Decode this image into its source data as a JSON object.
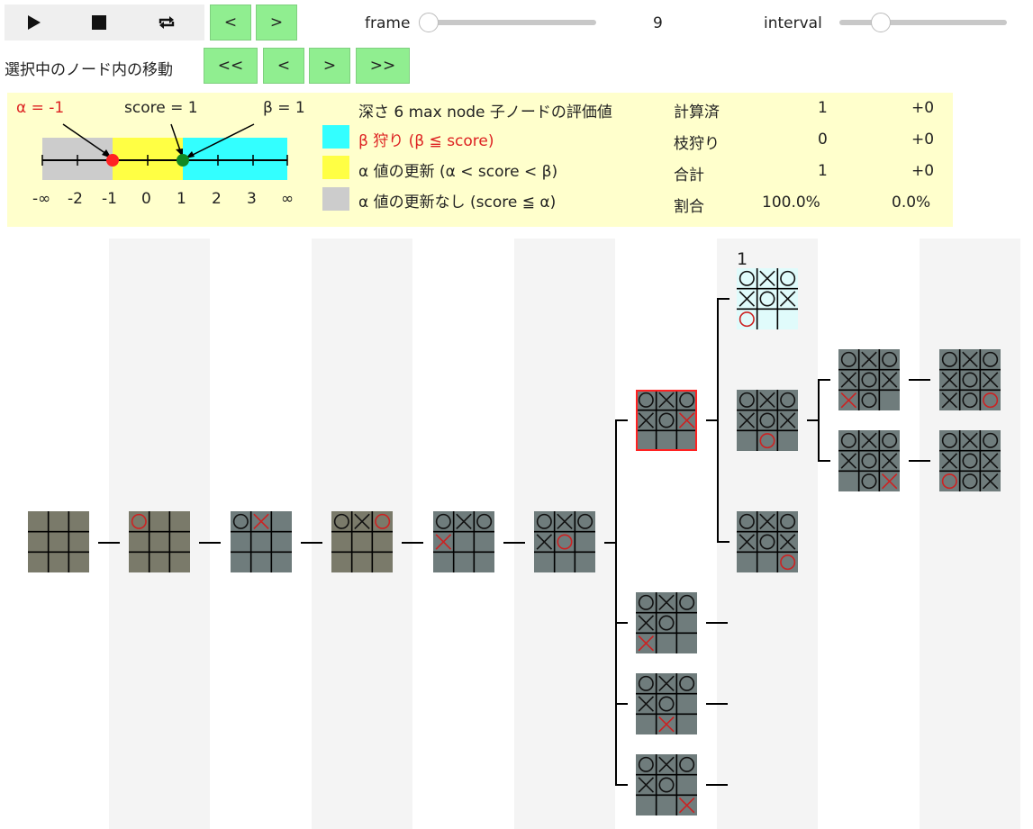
{
  "toolbar": {
    "play_icon": "play-icon",
    "stop_icon": "stop-icon",
    "repeat_icon": "repeat-icon",
    "prev_label": "<",
    "next_label": ">",
    "frame_label": "frame",
    "frame_value": "9",
    "frame_slider_fraction": 0.0,
    "interval_label": "interval",
    "interval_slider_fraction": 0.25
  },
  "node_nav": {
    "label": "選択中のノード内の移動",
    "first_label": "<<",
    "prev_label": "<",
    "next_label": ">",
    "last_label": ">>"
  },
  "info": {
    "alpha_label": "α = -1",
    "score_label": "score = 1",
    "beta_label": "β = 1",
    "axis_ticks": [
      "-∞",
      "-2",
      "-1",
      "0",
      "1",
      "2",
      "3",
      "∞"
    ],
    "legend": {
      "header": "深さ 6 max node 子ノードの評価値",
      "beta_cut": "β 狩り (β ≦ score)",
      "alpha_update": "α 値の更新 (α < score < β)",
      "alpha_no_update": "α 値の更新なし (score ≦ α)"
    },
    "stats": [
      {
        "label": "計算済",
        "value": "1",
        "delta": "+0"
      },
      {
        "label": "枝狩り",
        "value": "0",
        "delta": "+0"
      },
      {
        "label": "合計",
        "value": "1",
        "delta": "+0"
      },
      {
        "label": "割合",
        "value": "100.0%",
        "delta": "0.0%"
      }
    ],
    "colors": {
      "beta_cut": "#33ffff",
      "alpha_update": "#ffff44",
      "alpha_no_update": "#cccccc",
      "alpha_marker": "#ff2222",
      "score_marker": "#118822",
      "panel_bg": "#ffffcc"
    }
  },
  "tree": {
    "root": {
      "cells": "         "
    },
    "d1": {
      "cells": "o        "
    },
    "d2": {
      "cells": "ox       "
    },
    "d3": {
      "cells": "oxo      "
    },
    "d4": {
      "cells": "oxox     "
    },
    "d5": {
      "cells": "oxoxo    "
    },
    "d6": [
      {
        "cells": "oxoxox   ",
        "selected": true
      },
      {
        "cells": "oxoxo x  "
      },
      {
        "cells": "oxoxo  x "
      },
      {
        "cells": "oxoxo   x"
      }
    ],
    "d7": [
      {
        "cells": "oxoxoxo  ",
        "score": "1"
      },
      {
        "cells": "oxoxox o "
      },
      {
        "cells": "oxoxox  o"
      }
    ],
    "d8": [
      {
        "cells": "oxoxoxxo "
      },
      {
        "cells": "oxoxox ox"
      }
    ],
    "d9": [
      {
        "cells": "oxoxoxxoo"
      },
      {
        "cells": "oxoxoxoox"
      }
    ],
    "colors": {
      "max_turn_board": "#7a7a6a",
      "min_turn_board": "#6f7c7c",
      "evaluated_board": "#e0fbfb",
      "new_mark": "#cc2222",
      "selected_border": "#ff2222"
    }
  }
}
